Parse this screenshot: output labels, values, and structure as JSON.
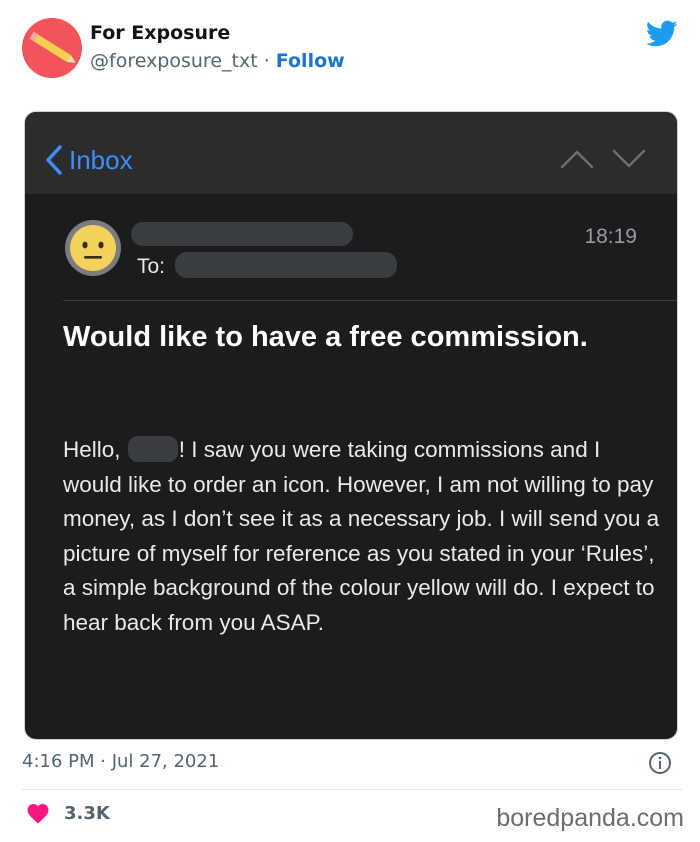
{
  "tweet": {
    "author_name": "For Exposure",
    "handle": "@forexposure_txt",
    "separator": " · ",
    "follow_label": "Follow",
    "timestamp": "4:16 PM · Jul 27, 2021",
    "like_count": "3.3K"
  },
  "email": {
    "back_label": "Inbox",
    "to_label": "To:",
    "time": "18:19",
    "subject": "Would like to have a free commission.",
    "greeting_before": "Hello, ",
    "greeting_after": "! I saw you were taking commissions and I would like to order an icon. However, I am not willing to pay money, as I don’t see it as a necessary job. I will send you a picture of myself for reference as you stated in your ‘Rules’, a simple background of the colour yellow will do. I expect to hear back from you ASAP."
  },
  "watermark": "boredpanda.com",
  "colors": {
    "twitter_blue": "#1d9bf0",
    "ios_blue": "#3b8ff6",
    "heart": "#f91880",
    "avatar_red": "#f2545b"
  },
  "icons": [
    "twitter-bird-icon",
    "chevron-left-icon",
    "chevron-up-icon",
    "chevron-down-icon",
    "neutral-face-icon",
    "info-icon",
    "heart-icon",
    "pencil-icon"
  ]
}
